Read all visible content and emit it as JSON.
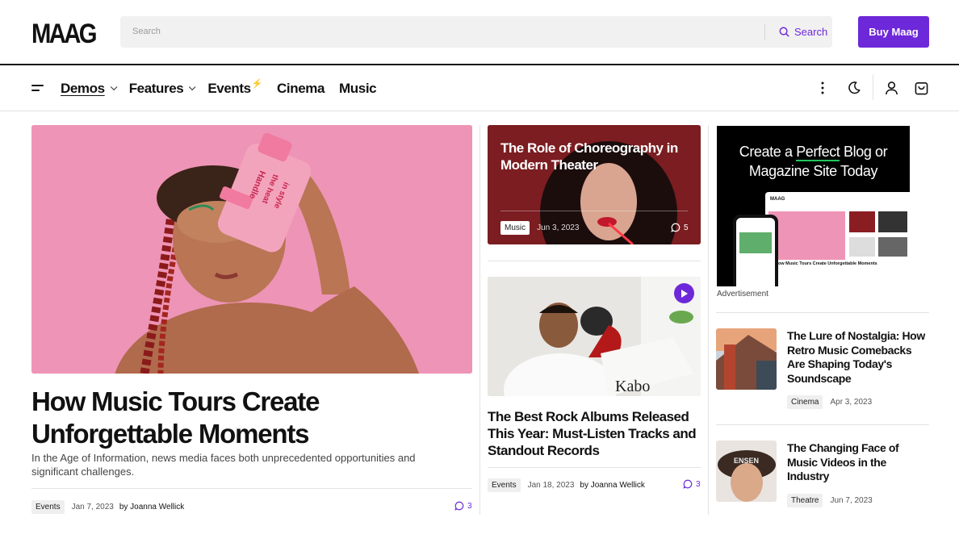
{
  "header": {
    "logo": "MAAG",
    "search_placeholder": "Search",
    "search_button": "Search",
    "buy_button": "Buy Maag"
  },
  "nav": {
    "items": [
      "Demos",
      "Features",
      "Events",
      "Cinema",
      "Music"
    ]
  },
  "hero": {
    "title": "How Music Tours Create Unforgettable Moments",
    "excerpt": "In the Age of Information, news media faces both unprecedented opportunities and significant challenges.",
    "tag": "Events",
    "date": "Jan 7, 2023",
    "author": "by Joanna Wellick",
    "comments": "3",
    "image_text": [
      "Handle",
      "Handle",
      "the heat",
      "in style"
    ]
  },
  "middle": {
    "card1": {
      "title": "The Role of Choreography in Modern Theater",
      "tag": "Music",
      "date": "Jun 3, 2023",
      "comments": "5"
    },
    "card2": {
      "title": "The Best Rock Albums Released This Year: Must-Listen Tracks and Standout Records",
      "tag": "Events",
      "date": "Jan 18, 2023",
      "author": "by Joanna Wellick",
      "comments": "3",
      "image_text": "Kabo"
    }
  },
  "ad": {
    "headline_a": "Create a ",
    "headline_u": "Perfect",
    "headline_b": " Blog or",
    "headline_c": "Magazine Site Today",
    "label": "Advertisement",
    "mock_logo": "MAAG",
    "mock_title": "How Music Tours Create Unforgettable Moments"
  },
  "sidebar": [
    {
      "title": "The Lure of Nostalgia: How Retro Music Comebacks Are Shaping Today's Soundscape",
      "tag": "Cinema",
      "date": "Apr 3, 2023"
    },
    {
      "title": "The Changing Face of Music Videos in the Industry",
      "tag": "Theatre",
      "date": "Jun 7, 2023",
      "image_text": "ENSEN"
    }
  ],
  "colors": {
    "accent": "#6d28d9",
    "hero_bg": "#ee94b6"
  }
}
